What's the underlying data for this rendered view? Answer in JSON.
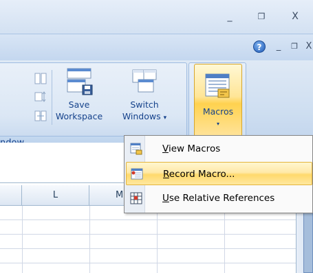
{
  "window_controls": {
    "minimize": "_",
    "restore": "❐",
    "close": "X"
  },
  "doc_controls": {
    "help": "?",
    "minimize": "_",
    "restore": "❐",
    "close": "X"
  },
  "ribbon": {
    "group_label": "ndow",
    "save_workspace": {
      "line1": "Save",
      "line2": "Workspace"
    },
    "switch_windows": {
      "line1": "Switch",
      "line2": "Windows",
      "arrow": "▾"
    },
    "macros": {
      "label": "Macros",
      "arrow": "▾"
    }
  },
  "grid": {
    "columns": [
      "L",
      "M"
    ]
  },
  "macro_menu": {
    "items": [
      {
        "mnemonic": "V",
        "rest": "iew Macros",
        "highlighted": false,
        "icon": "view-macros-icon"
      },
      {
        "mnemonic": "R",
        "rest": "ecord Macro...",
        "highlighted": true,
        "icon": "record-macro-icon"
      },
      {
        "mnemonic": "U",
        "rest": "se Relative References",
        "highlighted": false,
        "icon": "relative-references-icon"
      }
    ]
  },
  "colors": {
    "highlight": "#ffe9a8",
    "ribbon_text": "#15428b"
  }
}
